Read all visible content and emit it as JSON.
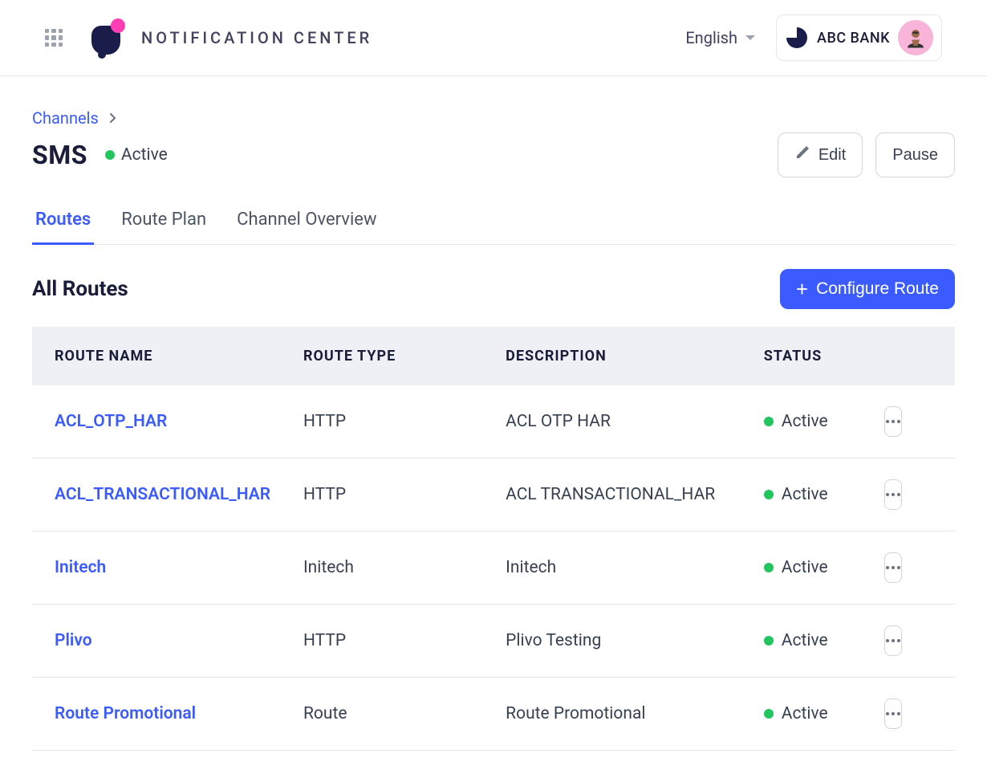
{
  "header": {
    "app_title": "NOTIFICATION CENTER",
    "language": "English",
    "org_name": "ABC BANK"
  },
  "breadcrumb": {
    "parent": "Channels"
  },
  "page": {
    "title": "SMS",
    "status": "Active",
    "edit_label": "Edit",
    "pause_label": "Pause"
  },
  "tabs": [
    {
      "label": "Routes",
      "active": true
    },
    {
      "label": "Route Plan",
      "active": false
    },
    {
      "label": "Channel Overview",
      "active": false
    }
  ],
  "section": {
    "title": "All Routes",
    "configure_label": "Configure Route"
  },
  "table": {
    "columns": [
      "ROUTE NAME",
      "ROUTE TYPE",
      "DESCRIPTION",
      "STATUS"
    ],
    "rows": [
      {
        "name": "ACL_OTP_HAR",
        "type": "HTTP",
        "description": "ACL OTP HAR",
        "status": "Active"
      },
      {
        "name": "ACL_TRANSACTIONAL_HAR",
        "type": "HTTP",
        "description": "ACL TRANSACTIONAL_HAR",
        "status": "Active"
      },
      {
        "name": "Initech",
        "type": "Initech",
        "description": "Initech",
        "status": "Active"
      },
      {
        "name": "Plivo",
        "type": "HTTP",
        "description": "Plivo Testing",
        "status": "Active"
      },
      {
        "name": "Route Promotional",
        "type": "Route",
        "description": "Route Promotional",
        "status": "Active"
      }
    ]
  }
}
